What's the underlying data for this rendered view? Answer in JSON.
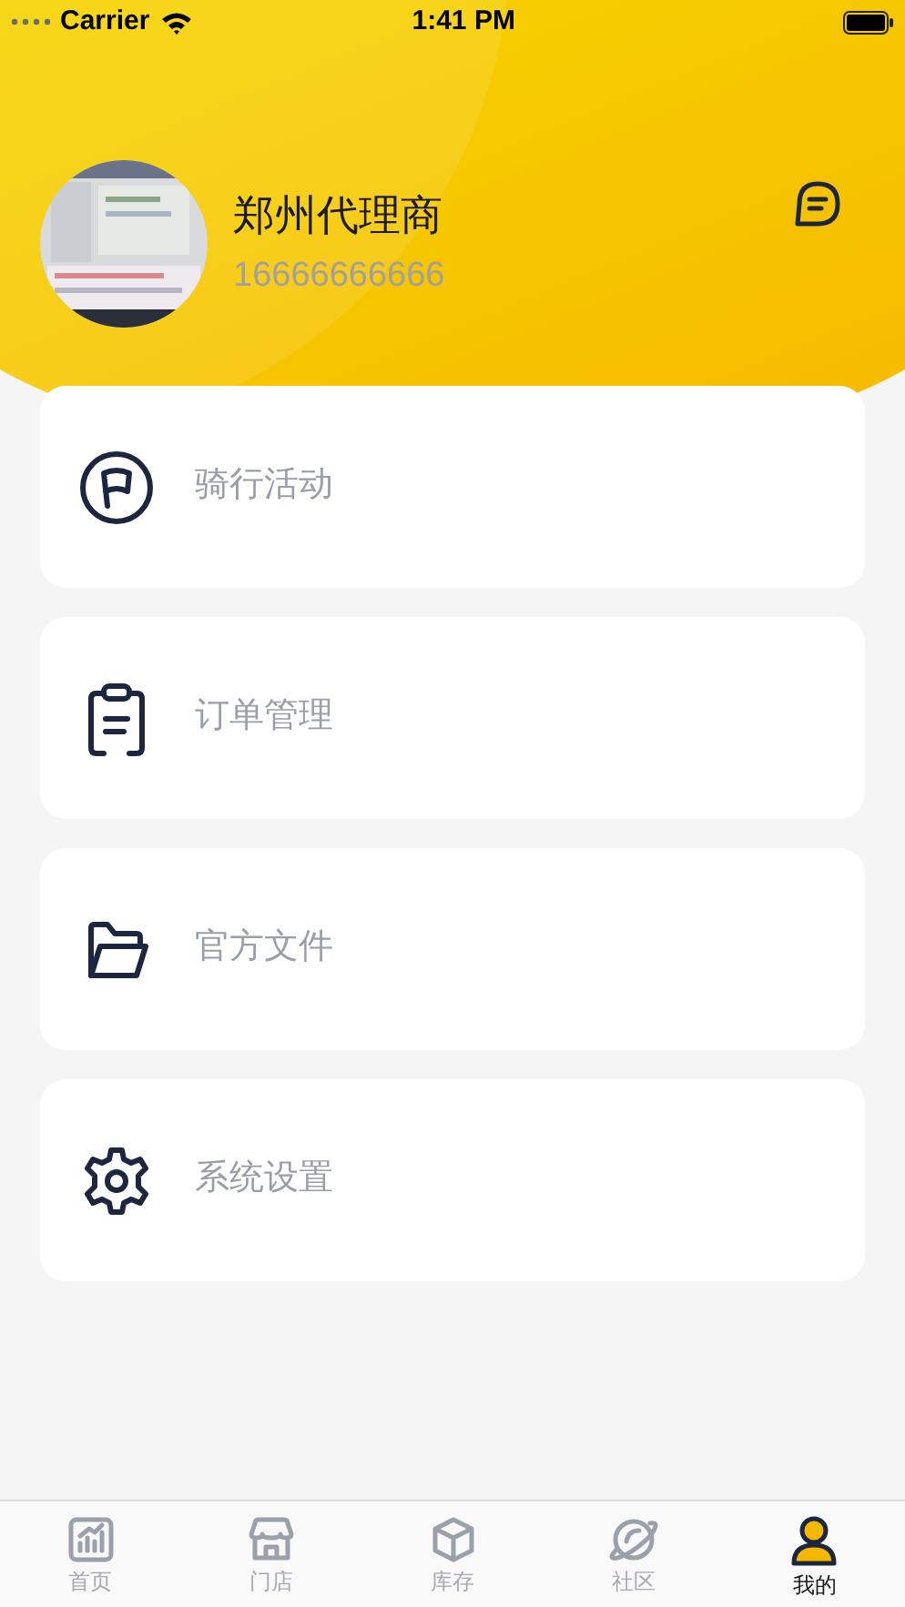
{
  "status_bar": {
    "carrier": "Carrier",
    "time": "1:41 PM"
  },
  "profile": {
    "name": "郑州代理商",
    "phone": "16666666666"
  },
  "menu": [
    {
      "kind": "flag",
      "label": "骑行活动"
    },
    {
      "kind": "clipboard",
      "label": "订单管理"
    },
    {
      "kind": "folder",
      "label": "官方文件"
    },
    {
      "kind": "gear",
      "label": "系统设置"
    }
  ],
  "tab_bar": [
    {
      "kind": "chart",
      "label": "首页",
      "selected": false
    },
    {
      "kind": "store",
      "label": "门店",
      "selected": false
    },
    {
      "kind": "box",
      "label": "库存",
      "selected": false
    },
    {
      "kind": "planet",
      "label": "社区",
      "selected": false
    },
    {
      "kind": "person",
      "label": "我的",
      "selected": true
    }
  ]
}
